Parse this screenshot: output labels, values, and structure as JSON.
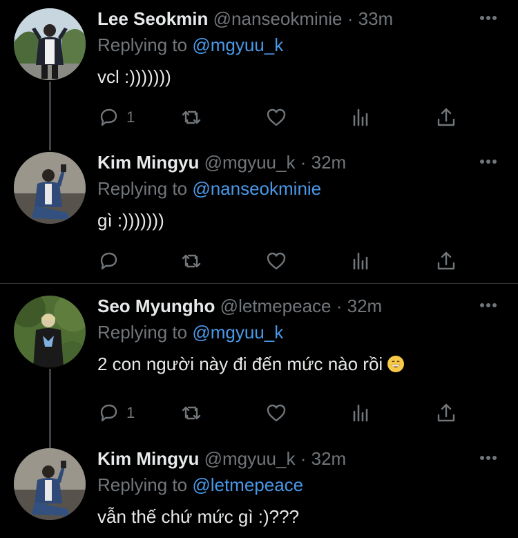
{
  "tweets": [
    {
      "name": "Lee Seokmin",
      "handle": "@nanseokminie",
      "dot": "·",
      "time": "33m",
      "replying_prefix": "Replying to",
      "replying_to": "@mgyuu_k",
      "text": "vcl :)))))))",
      "reply_count": "1",
      "avatar_icon": "profile-photo"
    },
    {
      "name": "Kim Mingyu",
      "handle": "@mgyuu_k",
      "dot": "·",
      "time": "32m",
      "replying_prefix": "Replying to",
      "replying_to": "@nanseokminie",
      "text": "gì :)))))))",
      "reply_count": "",
      "avatar_icon": "profile-photo"
    },
    {
      "name": "Seo Myungho",
      "handle": "@letmepeace",
      "dot": "·",
      "time": "32m",
      "replying_prefix": "Replying to",
      "replying_to": "@mgyuu_k",
      "text": "2 con người này đi đến mức nào rồi",
      "reply_count": "1",
      "avatar_icon": "profile-photo"
    },
    {
      "name": "Kim Mingyu",
      "handle": "@mgyuu_k",
      "dot": "·",
      "time": "32m",
      "replying_prefix": "Replying to",
      "replying_to": "@letmepeace",
      "text": "vẫn thế chứ mức gì :)???",
      "reply_count": "",
      "avatar_icon": "profile-photo"
    }
  ],
  "icons": {
    "more": "more-icon",
    "reply": "reply-icon",
    "retweet": "retweet-icon",
    "like": "like-icon",
    "analytics": "analytics-icon",
    "share": "share-icon",
    "emoji": "grinning-face-emoji"
  },
  "colors": {
    "background": "#000000",
    "link": "#4a99e9",
    "muted": "#71767b",
    "text": "#e7e9ea"
  }
}
